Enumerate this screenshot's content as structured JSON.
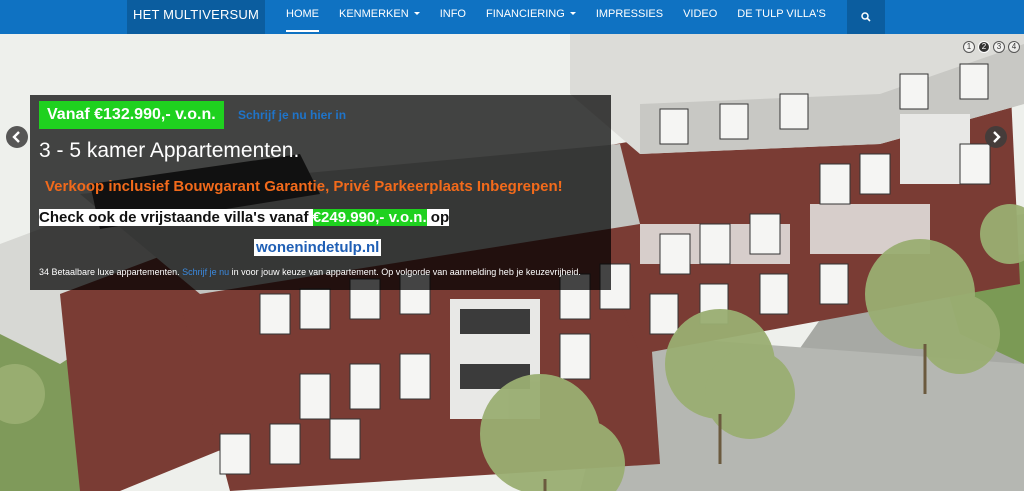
{
  "navbar": {
    "brand": "HET MULTIVERSUM",
    "items": [
      {
        "label": "HOME",
        "active": true,
        "dropdown": false
      },
      {
        "label": "KENMERKEN",
        "active": false,
        "dropdown": true
      },
      {
        "label": "INFO",
        "active": false,
        "dropdown": false
      },
      {
        "label": "FINANCIERING",
        "active": false,
        "dropdown": true
      },
      {
        "label": "IMPRESSIES",
        "active": false,
        "dropdown": false
      },
      {
        "label": "VIDEO",
        "active": false,
        "dropdown": false
      },
      {
        "label": "DE TULP VILLA'S",
        "active": false,
        "dropdown": false
      }
    ],
    "search_icon": "search-icon"
  },
  "carousel": {
    "indicators": [
      "1",
      "2",
      "3",
      "4"
    ],
    "active_indicator": 2,
    "prev_icon": "chevron-left-icon",
    "next_icon": "chevron-right-icon"
  },
  "caption": {
    "price": "Vanaf €132.990,- v.o.n.",
    "signup_link": "Schrijf je nu hier in",
    "headline": "3 - 5 kamer Appartementen.",
    "guarantee": "Verkoop inclusief Bouwgarant Garantie, Privé Parkeerplaats Inbegrepen!",
    "villa_prefix": "Check ook de vrijstaande villa's vanaf ",
    "villa_price": "€249.990,- v.o.n.",
    "villa_suffix": " op",
    "site": "wonenindetulp.nl",
    "small_prefix": "34 Betaalbare  luxe appartementen. ",
    "small_link": "Schrijf je nu",
    "small_suffix": " in voor jouw keuze van appartement. Op volgorde van aanmelding heb je keuzevrijheid."
  },
  "colors": {
    "nav_bg": "#0f72c2",
    "nav_dark": "#0b5d9f",
    "price_green": "#1fd11f",
    "orange": "#f26a1b",
    "brick": "#7a3c34"
  }
}
